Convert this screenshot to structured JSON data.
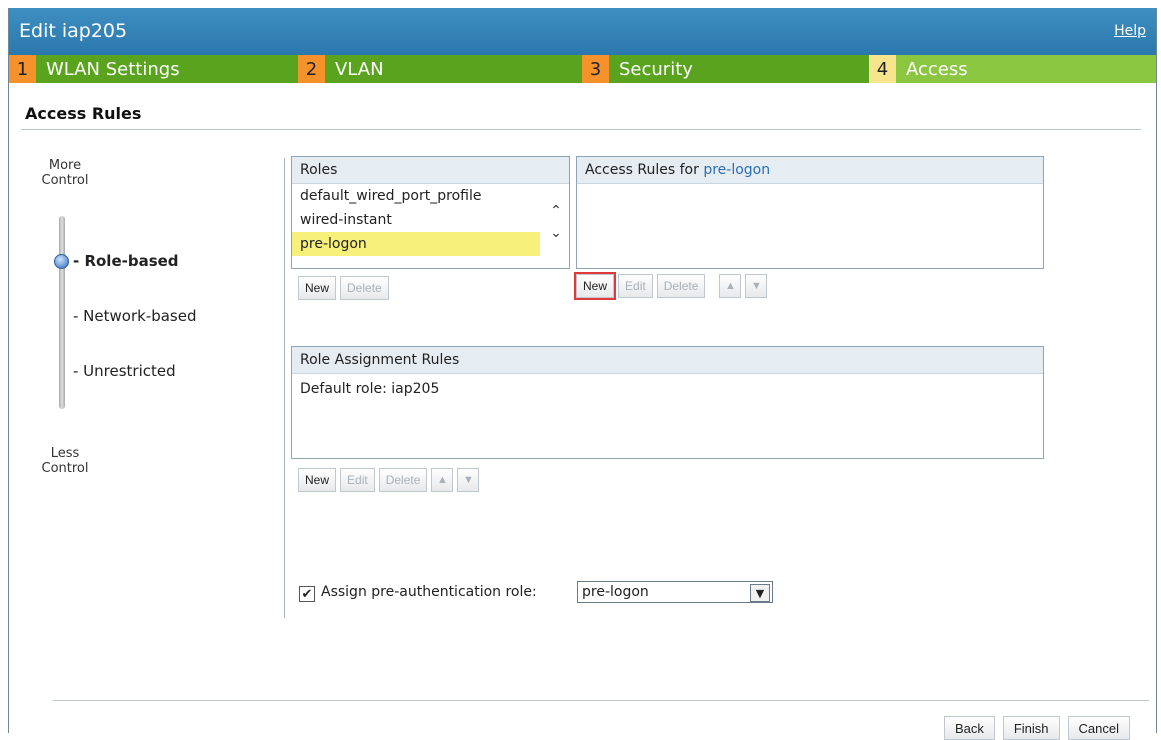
{
  "window": {
    "title": "Edit iap205",
    "help": "Help"
  },
  "steps": [
    {
      "num": "1",
      "label": "WLAN Settings"
    },
    {
      "num": "2",
      "label": "VLAN"
    },
    {
      "num": "3",
      "label": "Security"
    },
    {
      "num": "4",
      "label": "Access"
    }
  ],
  "section": {
    "title": "Access Rules"
  },
  "slider": {
    "more": "More Control",
    "less": "Less Control",
    "options": [
      "- Role-based",
      "- Network-based",
      "- Unrestricted"
    ],
    "selected": "- Role-based"
  },
  "roles": {
    "header": "Roles",
    "items": [
      "default_wired_port_profile",
      "wired-instant",
      "pre-logon"
    ],
    "selected": "pre-logon",
    "new": "New",
    "delete": "Delete"
  },
  "access_rules": {
    "header_prefix": "Access Rules for",
    "header_role": "pre-logon",
    "new": "New",
    "edit": "Edit",
    "delete": "Delete"
  },
  "assignment": {
    "header": "Role Assignment Rules",
    "default_role": "Default role: iap205",
    "new": "New",
    "edit": "Edit",
    "delete": "Delete"
  },
  "preauth": {
    "label": "Assign pre-authentication role:",
    "checked": true,
    "value": "pre-logon"
  },
  "footer": {
    "back": "Back",
    "finish": "Finish",
    "cancel": "Cancel"
  },
  "colors": {
    "titlebar": "#2f82b8",
    "step_green": "#5aa31e",
    "step_active": "#8bc640",
    "step_num": "#f6922b",
    "highlight": "#e0383b"
  }
}
